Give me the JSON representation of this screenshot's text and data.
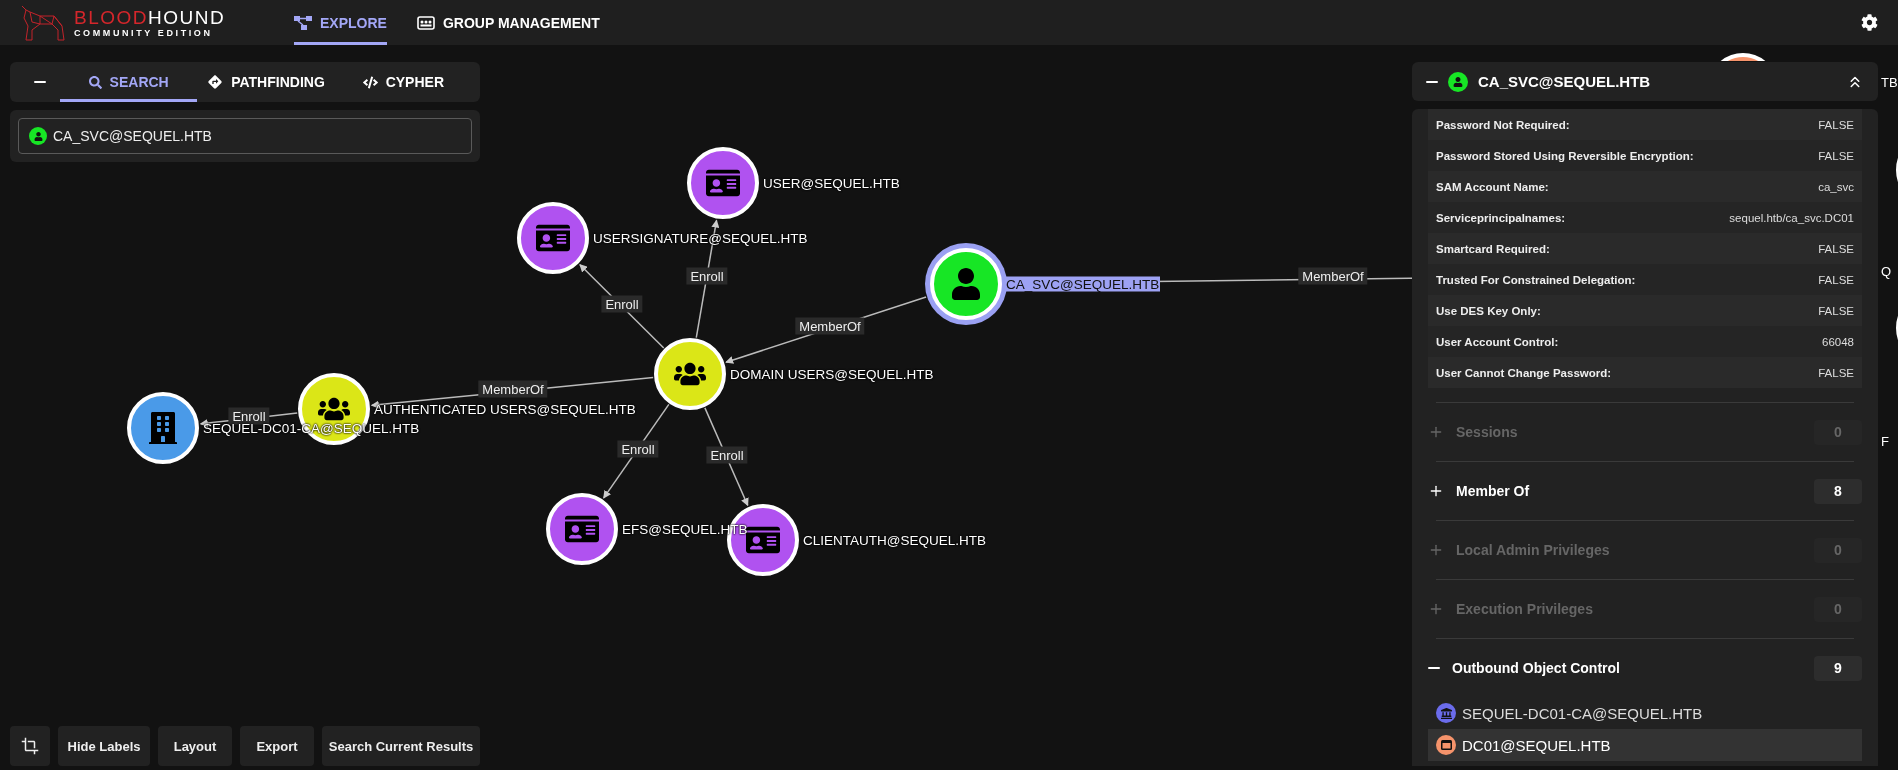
{
  "logo": {
    "brand_first": "BLOOD",
    "brand_second": "HOUND",
    "edition": "COMMUNITY EDITION"
  },
  "nav": [
    {
      "label": "EXPLORE",
      "kind": "explore",
      "selected": true
    },
    {
      "label": "GROUP MANAGEMENT",
      "kind": "groups",
      "selected": false
    }
  ],
  "search_panel": {
    "tabs": [
      {
        "label": "SEARCH",
        "kind": "search",
        "selected": true
      },
      {
        "label": "PATHFINDING",
        "kind": "pathfinding",
        "selected": false
      },
      {
        "label": "CYPHER",
        "kind": "cypher",
        "selected": false
      }
    ],
    "query": "CA_SVC@SEQUEL.HTB"
  },
  "graph": {
    "nodes": [
      {
        "label": "USER@SEQUEL.HTB",
        "kind": "cert_template",
        "selected": false
      },
      {
        "label": "USERSIGNATURE@SEQUEL.HTB",
        "kind": "cert_template",
        "selected": false
      },
      {
        "label": "CA_SVC@SEQUEL.HTB",
        "kind": "user",
        "selected": true
      },
      {
        "label": "DOMAIN USERS@SEQUEL.HTB",
        "kind": "group",
        "selected": false
      },
      {
        "label": "AUTHENTICATED USERS@SEQUEL.HTB",
        "kind": "group",
        "selected": false
      },
      {
        "label": "SEQUEL-DC01-CA@SEQUEL.HTB",
        "kind": "enterprise_ca",
        "selected": false
      },
      {
        "label": "EFS@SEQUEL.HTB",
        "kind": "cert_template",
        "selected": false
      },
      {
        "label": "CLIENTAUTH@SEQUEL.HTB",
        "kind": "cert_template",
        "selected": false
      }
    ],
    "edges": [
      {
        "label": "Enroll"
      },
      {
        "label": "Enroll"
      },
      {
        "label": "MemberOf"
      },
      {
        "label": "MemberOf"
      },
      {
        "label": "Enroll"
      },
      {
        "label": "Enroll"
      },
      {
        "label": "Enroll"
      },
      {
        "label": "MemberOf"
      }
    ],
    "clipped_labels": [
      "TB",
      "Q",
      "F"
    ]
  },
  "toolbar": {
    "buttons": [
      {
        "label": "Hide Labels"
      },
      {
        "label": "Layout"
      },
      {
        "label": "Export"
      },
      {
        "label": "Search Current Results"
      }
    ]
  },
  "details": {
    "title": "CA_SVC@SEQUEL.HTB",
    "properties": [
      {
        "name": "Password Not Required:",
        "value": "FALSE"
      },
      {
        "name": "Password Stored Using Reversible Encryption:",
        "value": "FALSE"
      },
      {
        "name": "SAM Account Name:",
        "value": "ca_svc"
      },
      {
        "name": "Serviceprincipalnames:",
        "value": "sequel.htb/ca_svc.DC01"
      },
      {
        "name": "Smartcard Required:",
        "value": "FALSE"
      },
      {
        "name": "Trusted For Constrained Delegation:",
        "value": "FALSE"
      },
      {
        "name": "Use DES Key Only:",
        "value": "FALSE"
      },
      {
        "name": "User Account Control:",
        "value": "66048"
      },
      {
        "name": "User Cannot Change Password:",
        "value": "FALSE"
      }
    ],
    "sections": [
      {
        "label": "Sessions",
        "count": "0",
        "disabled": true,
        "expanded": false
      },
      {
        "label": "Member Of",
        "count": "8",
        "disabled": false,
        "expanded": false
      },
      {
        "label": "Local Admin Privileges",
        "count": "0",
        "disabled": true,
        "expanded": false
      },
      {
        "label": "Execution Privileges",
        "count": "0",
        "disabled": true,
        "expanded": false
      },
      {
        "label": "Outbound Object Control",
        "count": "9",
        "disabled": false,
        "expanded": true
      }
    ],
    "outbound_items": [
      {
        "label": "SEQUEL-DC01-CA@SEQUEL.HTB",
        "kind": "enterprise_ca",
        "selected": false
      },
      {
        "label": "DC01@SEQUEL.HTB",
        "kind": "computer",
        "selected": true
      }
    ]
  }
}
